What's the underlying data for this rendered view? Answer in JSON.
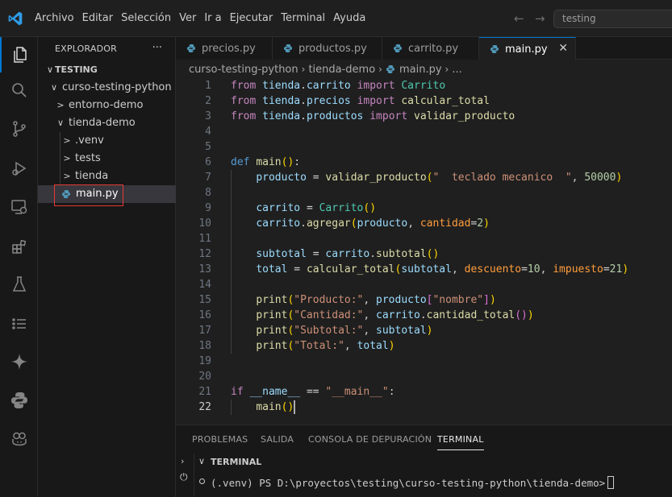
{
  "menu": [
    "Archivo",
    "Editar",
    "Selección",
    "Ver",
    "Ir a",
    "Ejecutar",
    "Terminal",
    "Ayuda"
  ],
  "search": {
    "value": "testing"
  },
  "sidebar": {
    "title": "EXPLORADOR",
    "more": "···",
    "tree": [
      {
        "label": "TESTING",
        "chevron": "∨"
      },
      {
        "label": "curso-testing-python",
        "chevron": "∨"
      },
      {
        "label": "entorno-demo",
        "chevron": ">"
      },
      {
        "label": "tienda-demo",
        "chevron": "∨"
      },
      {
        "label": ".venv",
        "chevron": ">"
      },
      {
        "label": "tests",
        "chevron": ">"
      },
      {
        "label": "tienda",
        "chevron": ">"
      },
      {
        "label": "main.py",
        "chevron": ""
      }
    ]
  },
  "tabs": [
    {
      "label": "precios.py"
    },
    {
      "label": "productos.py"
    },
    {
      "label": "carrito.py"
    },
    {
      "label": "main.py",
      "close": "✕"
    }
  ],
  "breadcrumb": {
    "folder1": "curso-testing-python",
    "folder2": "tienda-demo",
    "file": "main.py",
    "more": "..."
  },
  "editor": {
    "line_numbers": [
      "1",
      "2",
      "3",
      "4",
      "5",
      "6",
      "7",
      "8",
      "9",
      "10",
      "11",
      "12",
      "13",
      "14",
      "15",
      "16",
      "17",
      "18",
      "19",
      "20",
      "21",
      "22"
    ],
    "current_line": 22
  },
  "panel": {
    "tabs": [
      "PROBLEMAS",
      "SALIDA",
      "CONSOLA DE DEPURACIÓN",
      "TERMINAL"
    ],
    "active_tab": "TERMINAL",
    "section_title": "TERMINAL",
    "prompt": "(.venv) PS D:\\proyectos\\testing\\curso-testing-python\\tienda-demo>"
  },
  "colors": {
    "accent": "#0078d4",
    "selection_outline": "#e53935",
    "python_icon": "#519aba"
  }
}
